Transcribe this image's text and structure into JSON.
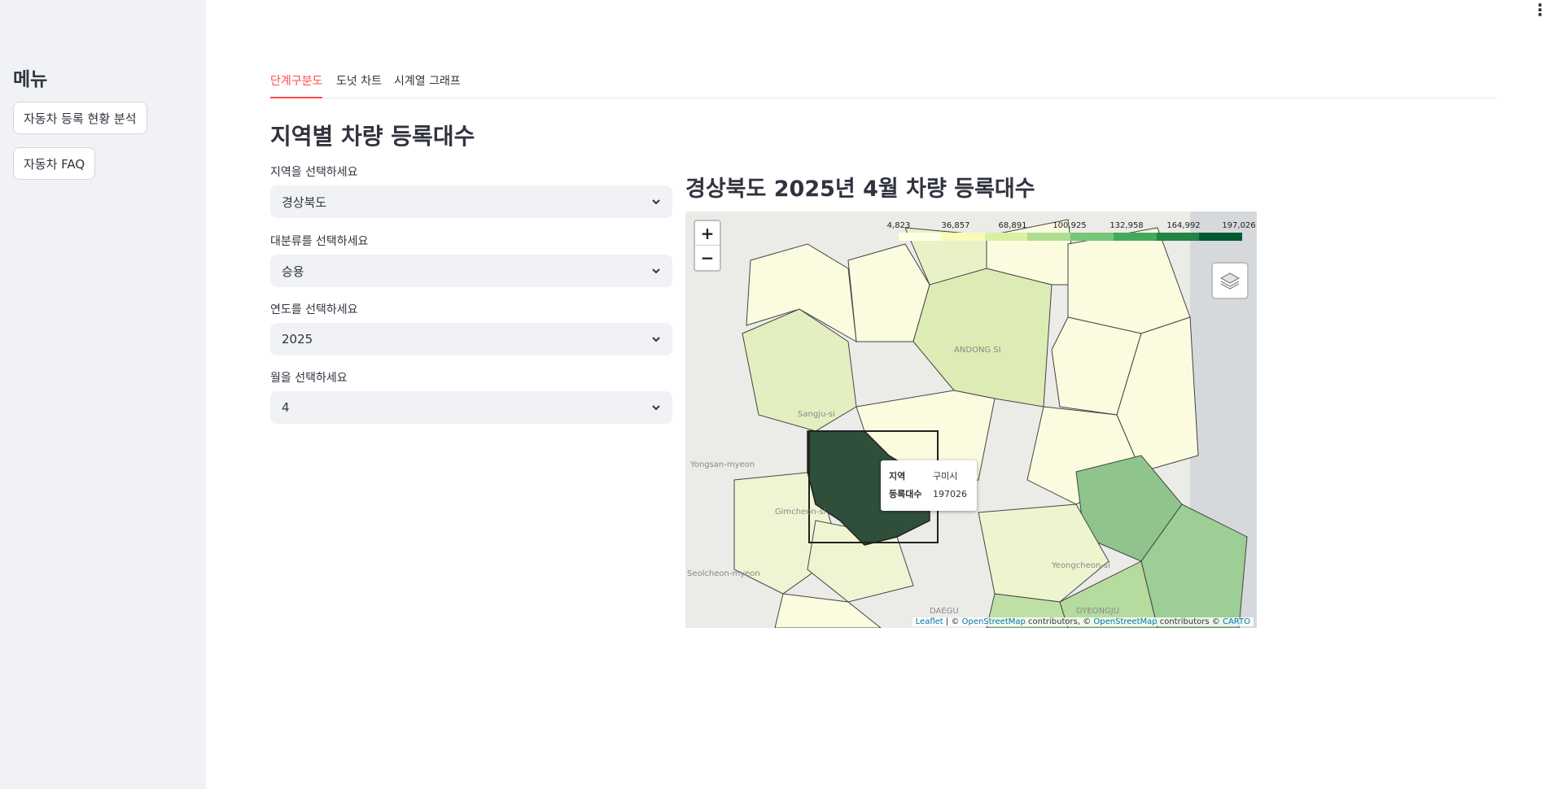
{
  "sidebar": {
    "title": "메뉴",
    "buttons": [
      "자동차 등록 현황 분석",
      "자동차 FAQ"
    ]
  },
  "tabs": [
    {
      "label": "단계구분도",
      "active": true
    },
    {
      "label": "도넛 차트",
      "active": false
    },
    {
      "label": "시계열 그래프",
      "active": false
    }
  ],
  "page_title": "지역별 차량 등록대수",
  "filters": [
    {
      "label": "지역을 선택하세요",
      "value": "경상북도"
    },
    {
      "label": "대분류를 선택하세요",
      "value": "승용"
    },
    {
      "label": "연도를 선택하세요",
      "value": "2025"
    },
    {
      "label": "월을 선택하세요",
      "value": "4"
    }
  ],
  "map": {
    "title": "경상북도 2025년 4월 차량 등록대수",
    "legend_ticks": [
      "4,823",
      "36,857",
      "68,891",
      "100,925",
      "132,958",
      "164,992",
      "197,026"
    ],
    "legend_colors": [
      "#ffffe5",
      "#f7fcb9",
      "#d9f0a3",
      "#addd8e",
      "#78c679",
      "#41ab5d",
      "#238443",
      "#005a32"
    ],
    "tooltip": {
      "region_key": "지역",
      "region_value": "구미시",
      "count_key": "등록대수",
      "count_value": "197026"
    },
    "labels": [
      "ANDONG SI",
      "Sangju-si",
      "Gimcheon-si",
      "DAEGU",
      "GYEONGJU",
      "Yeongcheon-si",
      "Yongsan-myeon",
      "Seolcheon-myeon"
    ],
    "attribution": {
      "leaflet": "Leaflet",
      "sep1": "| ©",
      "osm1": "OpenStreetMap",
      "mid": "contributors, ©",
      "osm2": "OpenStreetMap",
      "end": "contributors ©",
      "carto": "CARTO"
    },
    "zoom_in": "+",
    "zoom_out": "−"
  },
  "colors": {
    "accent": "#ff4b4b",
    "selected_region": "#2f4f3a"
  }
}
